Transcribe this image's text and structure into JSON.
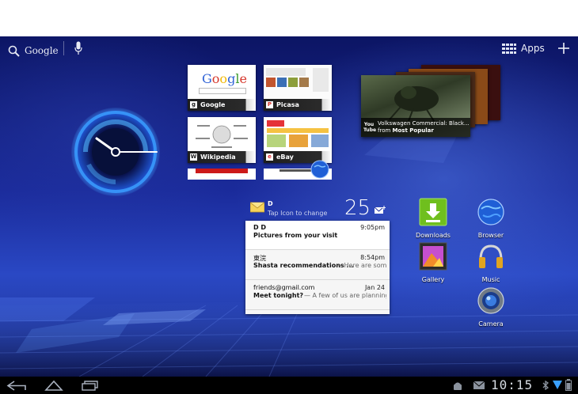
{
  "top_bar": {
    "search_label": "Google",
    "apps_label": "Apps"
  },
  "bookmarks": [
    {
      "name": "Google",
      "favicon": "g"
    },
    {
      "name": "Picasa",
      "favicon": "P"
    },
    {
      "name": "Wikipedia",
      "favicon": "W"
    },
    {
      "name": "eBay",
      "favicon": "e"
    }
  ],
  "youtube": {
    "logo": "You Tube",
    "title": "Volkswagen Commercial: Black...",
    "from_prefix": "from",
    "source": "Most Popular"
  },
  "gmail": {
    "account": "D",
    "hint": "Tap Icon to change",
    "unread_count": "25",
    "messages": [
      {
        "from": "D D",
        "time": "9:05pm",
        "subject": "Pictures from your visit",
        "snippet": ""
      },
      {
        "from": "東浣",
        "time": "8:54pm",
        "subject": "Shasta recommendations ...",
        "snippet": "— Here are some places that I think we should visit when"
      },
      {
        "from": "friends@gmail.com",
        "time": "Jan 24",
        "subject": "Meet tonight?",
        "snippet": "— A few of us are planning to meet tonight at"
      }
    ]
  },
  "apps": [
    {
      "label": "Downloads"
    },
    {
      "label": "Browser"
    },
    {
      "label": "Gallery"
    },
    {
      "label": "Music"
    },
    {
      "label": "Camera"
    }
  ],
  "system_bar": {
    "clock": "10:15"
  },
  "colors": {
    "wallpaper_dark": "#0c1564",
    "wallpaper_light": "#2a48c4",
    "clock_glow": "#46a8ff",
    "downloads_green": "#6fbf1e"
  }
}
